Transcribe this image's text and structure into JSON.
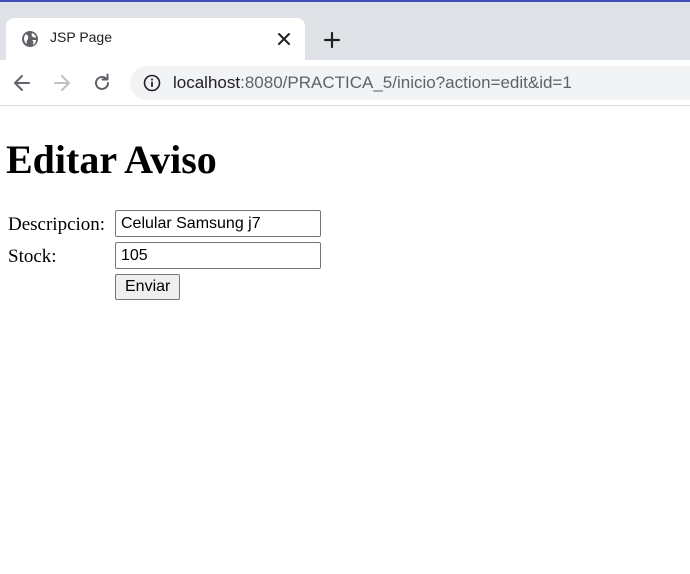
{
  "browser": {
    "tab": {
      "title": "JSP Page",
      "favicon_icon": "globe-icon",
      "close_icon": "close-icon"
    },
    "new_tab_icon": "plus-icon",
    "nav": {
      "back_icon": "arrow-left-icon",
      "forward_icon": "arrow-right-icon",
      "reload_icon": "reload-icon"
    },
    "address_bar": {
      "info_icon": "info-icon",
      "host": "localhost",
      "rest": ":8080/PRACTICA_5/inicio?action=edit&id=1"
    }
  },
  "page": {
    "title": "Editar Aviso",
    "form": {
      "descripcion_label": "Descripcion:",
      "descripcion_value": "Celular Samsung j7",
      "stock_label": "Stock:",
      "stock_value": "105",
      "submit_label": "Enviar"
    }
  }
}
